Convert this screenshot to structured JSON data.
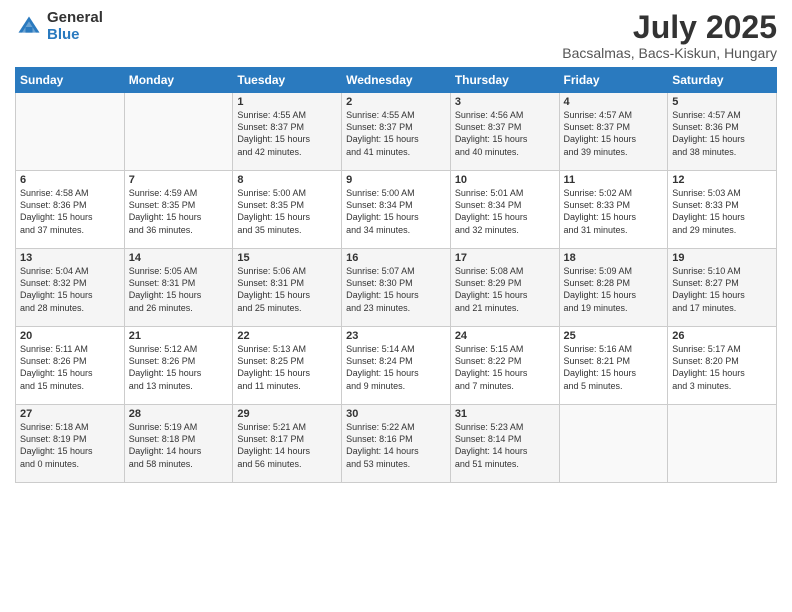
{
  "logo": {
    "general": "General",
    "blue": "Blue"
  },
  "header": {
    "title": "July 2025",
    "subtitle": "Bacsalmas, Bacs-Kiskun, Hungary"
  },
  "columns": [
    "Sunday",
    "Monday",
    "Tuesday",
    "Wednesday",
    "Thursday",
    "Friday",
    "Saturday"
  ],
  "weeks": [
    [
      {
        "day": "",
        "content": ""
      },
      {
        "day": "",
        "content": ""
      },
      {
        "day": "1",
        "content": "Sunrise: 4:55 AM\nSunset: 8:37 PM\nDaylight: 15 hours\nand 42 minutes."
      },
      {
        "day": "2",
        "content": "Sunrise: 4:55 AM\nSunset: 8:37 PM\nDaylight: 15 hours\nand 41 minutes."
      },
      {
        "day": "3",
        "content": "Sunrise: 4:56 AM\nSunset: 8:37 PM\nDaylight: 15 hours\nand 40 minutes."
      },
      {
        "day": "4",
        "content": "Sunrise: 4:57 AM\nSunset: 8:37 PM\nDaylight: 15 hours\nand 39 minutes."
      },
      {
        "day": "5",
        "content": "Sunrise: 4:57 AM\nSunset: 8:36 PM\nDaylight: 15 hours\nand 38 minutes."
      }
    ],
    [
      {
        "day": "6",
        "content": "Sunrise: 4:58 AM\nSunset: 8:36 PM\nDaylight: 15 hours\nand 37 minutes."
      },
      {
        "day": "7",
        "content": "Sunrise: 4:59 AM\nSunset: 8:35 PM\nDaylight: 15 hours\nand 36 minutes."
      },
      {
        "day": "8",
        "content": "Sunrise: 5:00 AM\nSunset: 8:35 PM\nDaylight: 15 hours\nand 35 minutes."
      },
      {
        "day": "9",
        "content": "Sunrise: 5:00 AM\nSunset: 8:34 PM\nDaylight: 15 hours\nand 34 minutes."
      },
      {
        "day": "10",
        "content": "Sunrise: 5:01 AM\nSunset: 8:34 PM\nDaylight: 15 hours\nand 32 minutes."
      },
      {
        "day": "11",
        "content": "Sunrise: 5:02 AM\nSunset: 8:33 PM\nDaylight: 15 hours\nand 31 minutes."
      },
      {
        "day": "12",
        "content": "Sunrise: 5:03 AM\nSunset: 8:33 PM\nDaylight: 15 hours\nand 29 minutes."
      }
    ],
    [
      {
        "day": "13",
        "content": "Sunrise: 5:04 AM\nSunset: 8:32 PM\nDaylight: 15 hours\nand 28 minutes."
      },
      {
        "day": "14",
        "content": "Sunrise: 5:05 AM\nSunset: 8:31 PM\nDaylight: 15 hours\nand 26 minutes."
      },
      {
        "day": "15",
        "content": "Sunrise: 5:06 AM\nSunset: 8:31 PM\nDaylight: 15 hours\nand 25 minutes."
      },
      {
        "day": "16",
        "content": "Sunrise: 5:07 AM\nSunset: 8:30 PM\nDaylight: 15 hours\nand 23 minutes."
      },
      {
        "day": "17",
        "content": "Sunrise: 5:08 AM\nSunset: 8:29 PM\nDaylight: 15 hours\nand 21 minutes."
      },
      {
        "day": "18",
        "content": "Sunrise: 5:09 AM\nSunset: 8:28 PM\nDaylight: 15 hours\nand 19 minutes."
      },
      {
        "day": "19",
        "content": "Sunrise: 5:10 AM\nSunset: 8:27 PM\nDaylight: 15 hours\nand 17 minutes."
      }
    ],
    [
      {
        "day": "20",
        "content": "Sunrise: 5:11 AM\nSunset: 8:26 PM\nDaylight: 15 hours\nand 15 minutes."
      },
      {
        "day": "21",
        "content": "Sunrise: 5:12 AM\nSunset: 8:26 PM\nDaylight: 15 hours\nand 13 minutes."
      },
      {
        "day": "22",
        "content": "Sunrise: 5:13 AM\nSunset: 8:25 PM\nDaylight: 15 hours\nand 11 minutes."
      },
      {
        "day": "23",
        "content": "Sunrise: 5:14 AM\nSunset: 8:24 PM\nDaylight: 15 hours\nand 9 minutes."
      },
      {
        "day": "24",
        "content": "Sunrise: 5:15 AM\nSunset: 8:22 PM\nDaylight: 15 hours\nand 7 minutes."
      },
      {
        "day": "25",
        "content": "Sunrise: 5:16 AM\nSunset: 8:21 PM\nDaylight: 15 hours\nand 5 minutes."
      },
      {
        "day": "26",
        "content": "Sunrise: 5:17 AM\nSunset: 8:20 PM\nDaylight: 15 hours\nand 3 minutes."
      }
    ],
    [
      {
        "day": "27",
        "content": "Sunrise: 5:18 AM\nSunset: 8:19 PM\nDaylight: 15 hours\nand 0 minutes."
      },
      {
        "day": "28",
        "content": "Sunrise: 5:19 AM\nSunset: 8:18 PM\nDaylight: 14 hours\nand 58 minutes."
      },
      {
        "day": "29",
        "content": "Sunrise: 5:21 AM\nSunset: 8:17 PM\nDaylight: 14 hours\nand 56 minutes."
      },
      {
        "day": "30",
        "content": "Sunrise: 5:22 AM\nSunset: 8:16 PM\nDaylight: 14 hours\nand 53 minutes."
      },
      {
        "day": "31",
        "content": "Sunrise: 5:23 AM\nSunset: 8:14 PM\nDaylight: 14 hours\nand 51 minutes."
      },
      {
        "day": "",
        "content": ""
      },
      {
        "day": "",
        "content": ""
      }
    ]
  ]
}
